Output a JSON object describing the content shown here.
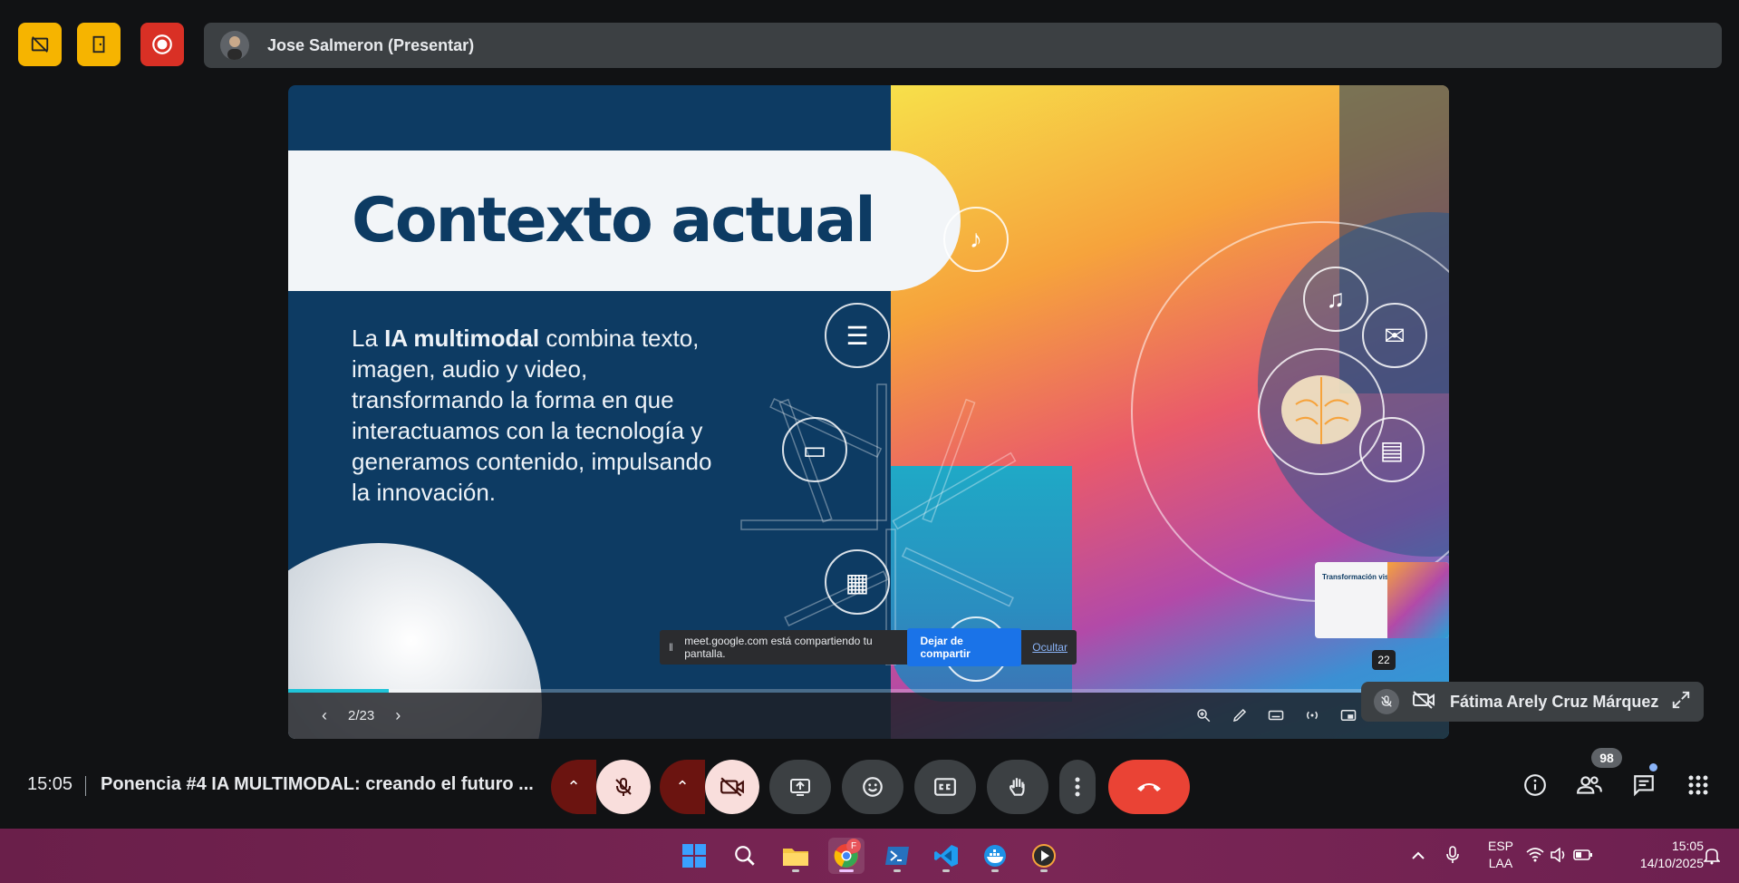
{
  "top_bar": {
    "presenter_label": "Jose Salmeron (Presentar)"
  },
  "slide": {
    "title": "Contexto actual",
    "body_prefix": "La ",
    "body_bold": "IA multimodal",
    "body_rest": " combina texto, imagen, audio y video, transformando la forma en que interactuamos con la tecnología y generamos contenido, impulsando la innovación.",
    "page_indicator": "2/23",
    "progress_fraction": 0.087,
    "thumbnail_title": "Transformación visual",
    "thumbnail_badge": "22"
  },
  "share_banner": {
    "message": "meet.google.com está compartiendo tu pantalla.",
    "stop_button": "Dejar de compartir",
    "hide_link": "Ocultar"
  },
  "participant": {
    "name": "Fátima Arely Cruz Márquez"
  },
  "meeting": {
    "time": "15:05",
    "title": "Ponencia #4 IA MULTIMODAL: creando el futuro ...",
    "participants_count": "98"
  },
  "taskbar": {
    "lang_top": "ESP",
    "lang_bottom": "LAA",
    "clock_time": "15:05",
    "clock_date": "14/10/2025",
    "chrome_profile_badge": "F"
  },
  "colors": {
    "accent_yellow": "#f6b400",
    "record_red": "#d93025",
    "end_call_red": "#ea4335",
    "slide_navy": "#0d3b63",
    "share_blue": "#1a73e8"
  }
}
